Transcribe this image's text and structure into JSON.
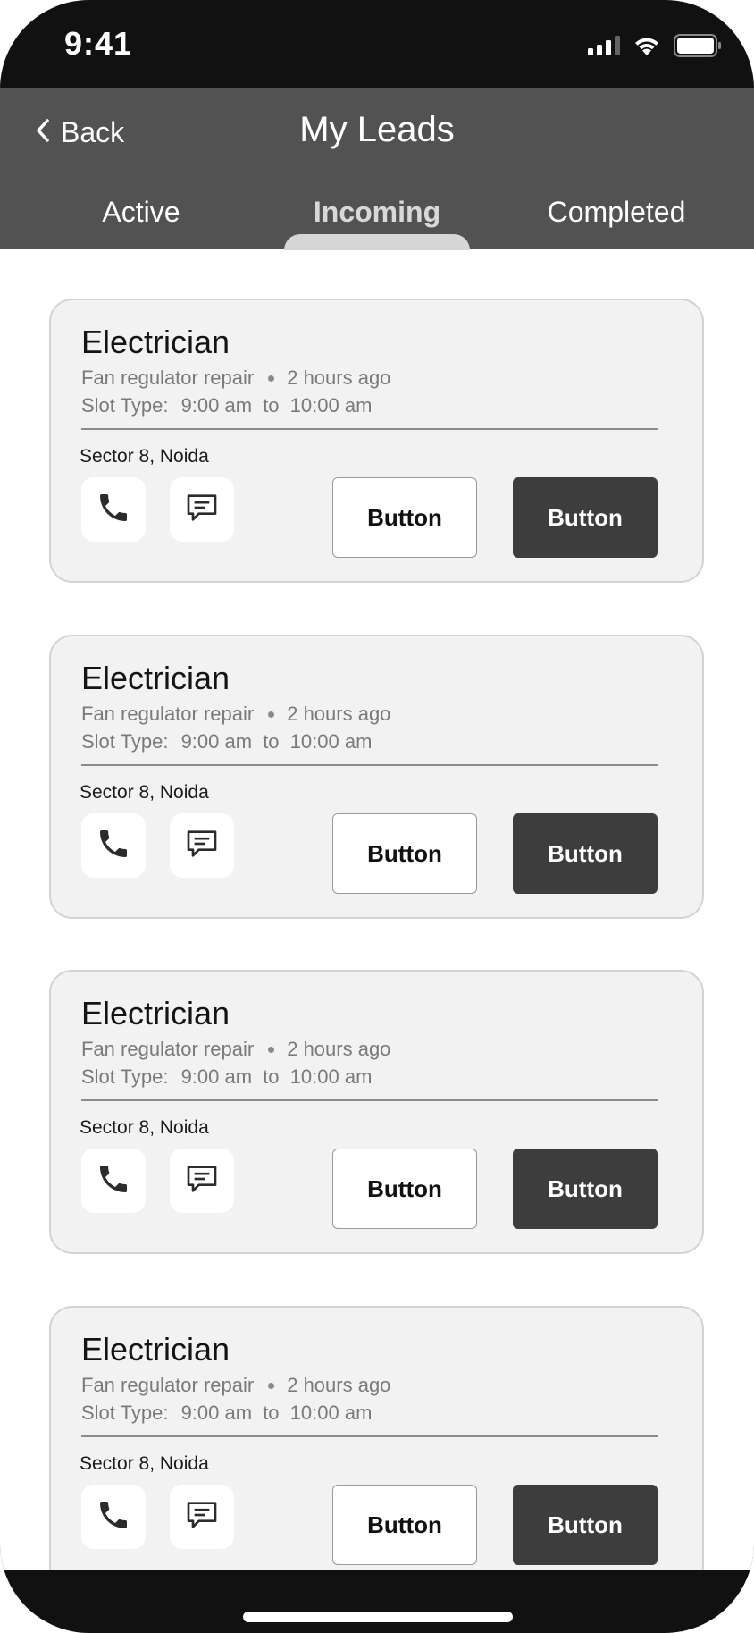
{
  "status_bar": {
    "time": "9:41"
  },
  "header": {
    "back_label": "Back",
    "title": "My Leads",
    "tabs": [
      {
        "label": "Active"
      },
      {
        "label": "Incoming"
      },
      {
        "label": "Completed"
      }
    ],
    "active_tab": "Incoming"
  },
  "leads": [
    {
      "title": "Electrician",
      "service": "Fan regulator repair",
      "time_ago": "2 hours ago",
      "slot_label": "Slot Type:",
      "slot_start": "9:00 am",
      "slot_sep": "to",
      "slot_end": "10:00 am",
      "address": "Sector 8, Noida",
      "secondary_button": "Button",
      "primary_button": "Button"
    },
    {
      "title": "Electrician",
      "service": "Fan regulator repair",
      "time_ago": "2 hours ago",
      "slot_label": "Slot Type:",
      "slot_start": "9:00 am",
      "slot_sep": "to",
      "slot_end": "10:00 am",
      "address": "Sector 8, Noida",
      "secondary_button": "Button",
      "primary_button": "Button"
    },
    {
      "title": "Electrician",
      "service": "Fan regulator repair",
      "time_ago": "2 hours ago",
      "slot_label": "Slot Type:",
      "slot_start": "9:00 am",
      "slot_sep": "to",
      "slot_end": "10:00 am",
      "address": "Sector 8, Noida",
      "secondary_button": "Button",
      "primary_button": "Button"
    },
    {
      "title": "Electrician",
      "service": "Fan regulator repair",
      "time_ago": "2 hours ago",
      "slot_label": "Slot Type:",
      "slot_start": "9:00 am",
      "slot_sep": "to",
      "slot_end": "10:00 am",
      "address": "Sector 8, Noida",
      "secondary_button": "Button",
      "primary_button": "Button"
    }
  ],
  "icons": {
    "back": "chevron-left-icon",
    "call": "phone-icon",
    "chat": "message-icon",
    "signal": "cellular-signal-icon",
    "wifi": "wifi-icon",
    "battery": "battery-icon"
  },
  "colors": {
    "header_bg": "#525252",
    "primary_button_bg": "#3d3d3d",
    "card_bg": "#f2f2f2"
  }
}
